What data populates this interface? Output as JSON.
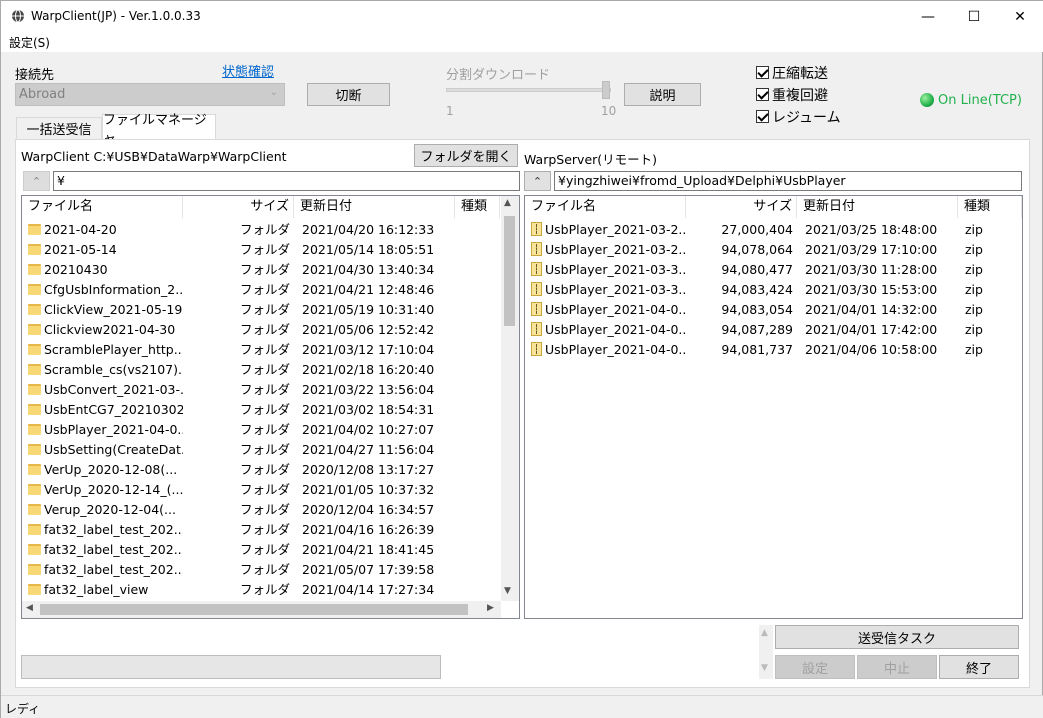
{
  "window": {
    "title": "WarpClient(JP) - Ver.1.0.0.33",
    "minimize": "—",
    "maximize": "☐",
    "close": "✕"
  },
  "menu": {
    "settings": "設定(S)"
  },
  "connection": {
    "label": "接続先",
    "status_link": "状態確認",
    "selected": "Abroad",
    "disconnect_button": "切断"
  },
  "split_download": {
    "label": "分割ダウンロード",
    "min": "1",
    "max": "10",
    "value": 10,
    "explain_button": "説明"
  },
  "options": {
    "compress": "圧縮転送",
    "dedupe": "重複回避",
    "resume": "レジューム"
  },
  "status": {
    "online": "On Line(TCP)",
    "color": "#22b14c"
  },
  "tabs": [
    {
      "label": "一括送受信"
    },
    {
      "label": "ファイルマネージャ"
    }
  ],
  "local": {
    "header": "WarpClient C:¥USB¥DataWarp¥WarpClient",
    "open_folder_button": "フォルダを開く",
    "path": "¥",
    "columns": {
      "name": "ファイル名",
      "size": "サイズ",
      "date": "更新日付",
      "type": "種類"
    },
    "rows": [
      {
        "name": "2021-04-20",
        "size": "フォルダ",
        "date": "2021/04/20 16:12:33",
        "type": ""
      },
      {
        "name": "2021-05-14",
        "size": "フォルダ",
        "date": "2021/05/14 18:05:51",
        "type": ""
      },
      {
        "name": "20210430",
        "size": "フォルダ",
        "date": "2021/04/30 13:40:34",
        "type": ""
      },
      {
        "name": "CfgUsbInformation_2...",
        "size": "フォルダ",
        "date": "2021/04/21 12:48:46",
        "type": ""
      },
      {
        "name": "ClickView_2021-05-19",
        "size": "フォルダ",
        "date": "2021/05/19 10:31:40",
        "type": ""
      },
      {
        "name": "Clickview2021-04-30",
        "size": "フォルダ",
        "date": "2021/05/06 12:52:42",
        "type": ""
      },
      {
        "name": "ScramblePlayer_http...",
        "size": "フォルダ",
        "date": "2021/03/12 17:10:04",
        "type": ""
      },
      {
        "name": "Scramble_cs(vs2107)...",
        "size": "フォルダ",
        "date": "2021/02/18 16:20:40",
        "type": ""
      },
      {
        "name": "UsbConvert_2021-03-...",
        "size": "フォルダ",
        "date": "2021/03/22 13:56:04",
        "type": ""
      },
      {
        "name": "UsbEntCG7_20210302",
        "size": "フォルダ",
        "date": "2021/03/02 18:54:31",
        "type": ""
      },
      {
        "name": "UsbPlayer_2021-04-0...",
        "size": "フォルダ",
        "date": "2021/04/02 10:27:07",
        "type": ""
      },
      {
        "name": "UsbSetting(CreateDat...",
        "size": "フォルダ",
        "date": "2021/04/27 11:56:04",
        "type": ""
      },
      {
        "name": "VerUp_2020-12-08(...",
        "size": "フォルダ",
        "date": "2020/12/08 13:17:27",
        "type": ""
      },
      {
        "name": "VerUp_2020-12-14_(...",
        "size": "フォルダ",
        "date": "2021/01/05 10:37:32",
        "type": ""
      },
      {
        "name": "Verup_2020-12-04(...",
        "size": "フォルダ",
        "date": "2020/12/04 16:34:57",
        "type": ""
      },
      {
        "name": "fat32_label_test_202...",
        "size": "フォルダ",
        "date": "2021/04/16 16:26:39",
        "type": ""
      },
      {
        "name": "fat32_label_test_202...",
        "size": "フォルダ",
        "date": "2021/04/21 18:41:45",
        "type": ""
      },
      {
        "name": "fat32_label_test_202...",
        "size": "フォルダ",
        "date": "2021/05/07 17:39:58",
        "type": ""
      },
      {
        "name": "fat32_label_view",
        "size": "フォルダ",
        "date": "2021/04/14 17:27:34",
        "type": ""
      }
    ]
  },
  "remote": {
    "header": "WarpServer(リモート)",
    "path": "¥yingzhiwei¥fromd_Upload¥Delphi¥UsbPlayer",
    "columns": {
      "name": "ファイル名",
      "size": "サイズ",
      "date": "更新日付",
      "type": "種類"
    },
    "rows": [
      {
        "name": "UsbPlayer_2021-03-2...",
        "size": "27,000,404",
        "date": "2021/03/25 18:48:00",
        "type": "zip"
      },
      {
        "name": "UsbPlayer_2021-03-2...",
        "size": "94,078,064",
        "date": "2021/03/29 17:10:00",
        "type": "zip"
      },
      {
        "name": "UsbPlayer_2021-03-3...",
        "size": "94,080,477",
        "date": "2021/03/30 11:28:00",
        "type": "zip"
      },
      {
        "name": "UsbPlayer_2021-03-3...",
        "size": "94,083,424",
        "date": "2021/03/30 15:53:00",
        "type": "zip"
      },
      {
        "name": "UsbPlayer_2021-04-0...",
        "size": "94,083,054",
        "date": "2021/04/01 14:32:00",
        "type": "zip"
      },
      {
        "name": "UsbPlayer_2021-04-0...",
        "size": "94,087,289",
        "date": "2021/04/01 17:42:00",
        "type": "zip"
      },
      {
        "name": "UsbPlayer_2021-04-0...",
        "size": "94,081,737",
        "date": "2021/04/06 10:58:00",
        "type": "zip"
      }
    ]
  },
  "bottom": {
    "task_button": "送受信タスク",
    "settings_button": "設定",
    "stop_button": "中止",
    "exit_button": "終了"
  },
  "statusbar": {
    "text": "レディ"
  }
}
